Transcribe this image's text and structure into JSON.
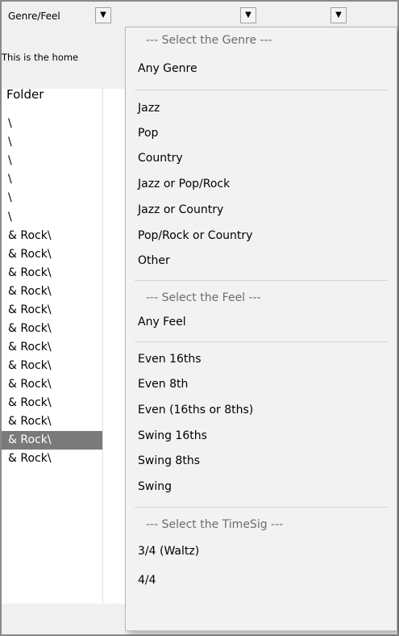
{
  "toolbar": {
    "genre_label": "Genre/Feel",
    "dropdown_arrow": "▼"
  },
  "infobar": {
    "text": "This is the home"
  },
  "list": {
    "header": "Folder",
    "rows": [
      "\\",
      "\\",
      "\\",
      "\\",
      "\\",
      "\\",
      "& Rock\\",
      "& Rock\\",
      "& Rock\\",
      "& Rock\\",
      "& Rock\\",
      "& Rock\\",
      "& Rock\\",
      "& Rock\\",
      "& Rock\\",
      "& Rock\\",
      "& Rock\\",
      "& Rock\\",
      "& Rock\\"
    ],
    "selected_index": 17
  },
  "menu": {
    "genre_header": "--- Select the Genre ---",
    "any_genre": "Any Genre",
    "genres": [
      "Jazz",
      "Pop",
      "Country",
      "Jazz or Pop/Rock",
      "Jazz or Country",
      "Pop/Rock or Country",
      "Other"
    ],
    "feel_header": "--- Select the Feel ---",
    "any_feel": "Any Feel",
    "feels": [
      "Even 16ths",
      "Even 8th",
      "Even (16ths or 8ths)",
      "Swing 16ths",
      "Swing 8ths",
      "Swing"
    ],
    "timesig_header": "--- Select the TimeSig ---",
    "timesigs": [
      "3/4 (Waltz)",
      "4/4"
    ]
  },
  "colors": {
    "selected_row_bg": "#7a7a7a",
    "menu_bg": "#f2f2f2",
    "header_text": "#6d6d6d"
  }
}
